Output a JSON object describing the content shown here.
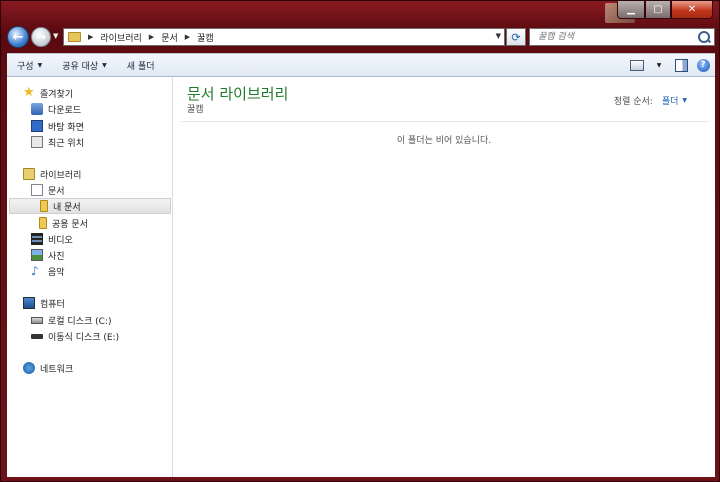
{
  "window": {
    "caption_buttons": [
      "minimize-icon",
      "maximize-icon",
      "close-icon"
    ]
  },
  "nav": {
    "back_icon": "back-arrow-icon",
    "forward_icon": "forward-arrow-icon"
  },
  "address": {
    "crumbs": [
      "라이브러리",
      "문서",
      "꿀캠"
    ]
  },
  "search": {
    "placeholder": "꿀캠 검색"
  },
  "toolbar": {
    "organize": "구성",
    "share": "공유 대상",
    "new_folder": "새 폴더"
  },
  "sidebar": {
    "favorites": "즐겨찾기",
    "downloads": "다운로드",
    "desktop": "바탕 화면",
    "recent": "최근 위치",
    "libraries": "라이브러리",
    "documents": "문서",
    "my_documents": "내 문서",
    "public_documents": "공용 문서",
    "videos": "비디오",
    "pictures": "사진",
    "music": "음악",
    "computer": "컴퓨터",
    "local_disk": "로컬 디스크 (C:)",
    "removable_disk": "이동식 디스크 (E:)",
    "network": "네트워크"
  },
  "content": {
    "library_title": "문서 라이브러리",
    "library_subtitle": "꿀캠",
    "sort_label": "정렬 순서:",
    "sort_value": "폴더",
    "empty_message": "이 폴더는 비어 있습니다."
  }
}
